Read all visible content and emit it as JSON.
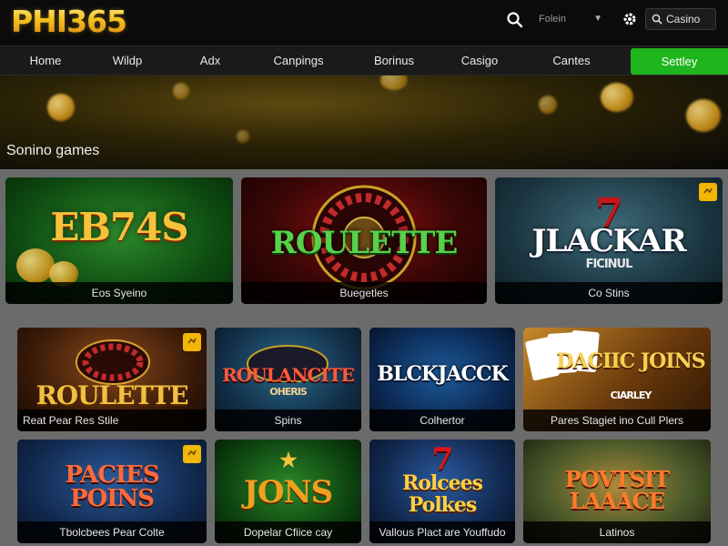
{
  "brand": {
    "logo_text": "PHI365"
  },
  "header": {
    "select_label": "Folein",
    "search_label": "Casino"
  },
  "nav": {
    "items": [
      "Home",
      "Wildp",
      "Adx",
      "Canpings",
      "Borinus",
      "Casigo",
      "Cantes"
    ],
    "cta_label": "Settley"
  },
  "hero": {
    "title": "Sonino games"
  },
  "games": [
    {
      "art_text": "EB74S",
      "caption": "Eos Syeino"
    },
    {
      "art_text": "ROULETTE",
      "caption": "Buegetles"
    },
    {
      "art_text": "JLACKAR",
      "art_sub": "FICINUL",
      "caption": "Co Stins"
    },
    {
      "art_text": "ROULETTE",
      "caption": "Reat Pear Res Stile"
    },
    {
      "art_text": "ROULANCITE",
      "art_sub": "OHERIS",
      "caption": "Spins"
    },
    {
      "art_text": "BLCKJACCK",
      "caption": "Colhertor"
    },
    {
      "art_text": "DACIIC JOINS",
      "art_sub": "CIARLEY",
      "caption": "Pares Stagiet ino Cull Plers"
    },
    {
      "art_text": "PACIES POINS",
      "caption": "Tbolcbees Pear Colte"
    },
    {
      "art_text": "JONS",
      "caption": "Dopelar Cfiice cay"
    },
    {
      "art_text": "Rolcees Polkes",
      "caption": "Vallous Plact are Youffudo"
    },
    {
      "art_text": "POVTSIT LAAACE",
      "caption": "Latinos"
    }
  ],
  "colors": {
    "accent_green": "#1fb51f",
    "brand_gold": "#f1c21b",
    "badge_yellow": "#f2b705"
  },
  "icons": [
    "search-icon",
    "chevron-down-icon",
    "gear-icon",
    "badge-icon"
  ]
}
